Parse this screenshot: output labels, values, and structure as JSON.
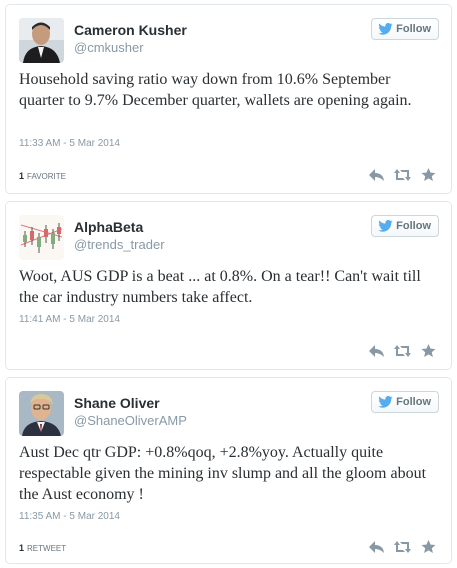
{
  "colors": {
    "bird": "#55acee",
    "icon": "#8899a6"
  },
  "tweets": [
    {
      "name": "Cameron Kusher",
      "handle": "@cmkusher",
      "follow_label": "Follow",
      "text": "Household saving ratio way down from 10.6% September quarter to 9.7% December quarter, wallets are opening again.",
      "timestamp": "11:33 AM - 5 Mar 2014",
      "stat_count": "1",
      "stat_label": "FAVORITE",
      "avatar_icon": "person-portrait"
    },
    {
      "name": "AlphaBeta",
      "handle": "@trends_trader",
      "follow_label": "Follow",
      "text": "Woot, AUS GDP is a beat ... at 0.8%. On a tear!! Can't wait till the car industry numbers take affect.",
      "timestamp": "11:41 AM - 5 Mar 2014",
      "avatar_icon": "candlestick-chart"
    },
    {
      "name": "Shane Oliver",
      "handle": "@ShaneOliverAMP",
      "follow_label": "Follow",
      "text": "Aust Dec qtr GDP: +0.8%qoq, +2.8%yoy. Actually quite respectable given the mining inv slump and all the gloom about the Aust economy !",
      "timestamp": "11:35 AM - 5 Mar 2014",
      "stat_count": "1",
      "stat_label": "RETWEET",
      "avatar_icon": "person-portrait"
    }
  ]
}
